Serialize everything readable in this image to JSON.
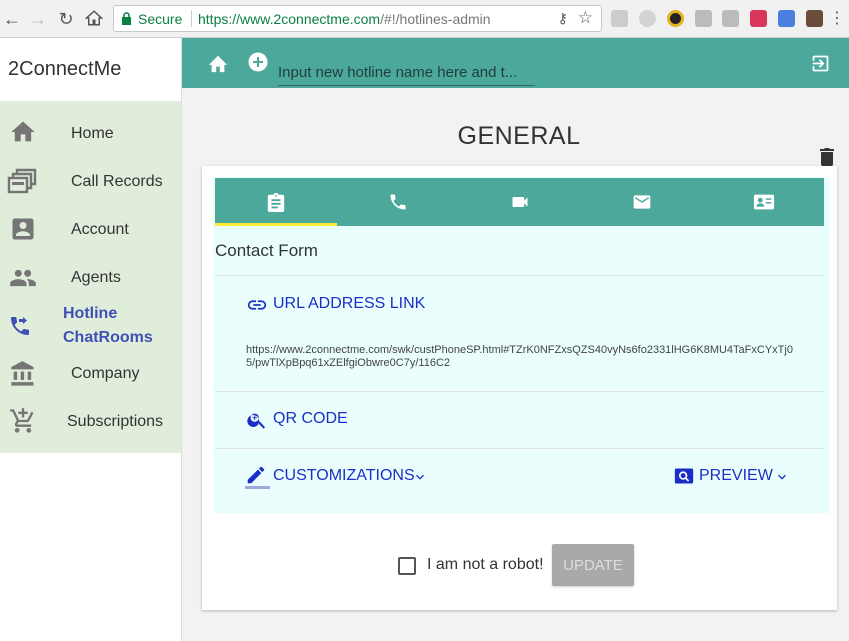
{
  "browser": {
    "secure_label": "Secure",
    "url_host": "https://www.2connectme.com",
    "url_path": "/#!/hotlines-admin"
  },
  "sidebar": {
    "brand": "2ConnectMe",
    "items": [
      {
        "label": "Home",
        "icon": "home-icon"
      },
      {
        "label": "Call Records",
        "icon": "records-icon"
      },
      {
        "label": "Account",
        "icon": "account-icon"
      },
      {
        "label": "Agents",
        "icon": "agents-icon"
      },
      {
        "label": "Hotline",
        "label2": "ChatRooms",
        "icon": "phone-forward-icon",
        "active": true
      },
      {
        "label": "Company",
        "icon": "bank-icon"
      },
      {
        "label": "Subscriptions",
        "icon": "cart-icon"
      }
    ]
  },
  "appbar": {
    "input_placeholder": "Input new hotline name here and t..."
  },
  "page": {
    "title": "GENERAL"
  },
  "panel": {
    "tabs": [
      "clipboard-icon",
      "phone-icon",
      "video-icon",
      "mail-icon",
      "contact-card-icon"
    ],
    "section_title": "Contact Form",
    "url_link_label": "URL ADDRESS LINK",
    "url_value": "https://www.2connectme.com/swk/custPhoneSP.html#TZrK0NFZxsQZS40vyNs6fo2331lHG6K8MU4TaFxCYxTj05/pwTlXpBpq61xZElfgiObwre0C7y/116C2",
    "qr_label": "QR CODE",
    "customizations_label": "CUSTOMIZATIONS",
    "preview_label": "PREVIEW"
  },
  "footer": {
    "robot_label": "I am not a robot!",
    "update_label": "UPDATE"
  },
  "colors": {
    "teal": "#4da89c",
    "link_blue": "#1a2fc7",
    "sidebar_bg": "#e0eddb",
    "panel_bg": "#eafffd"
  }
}
